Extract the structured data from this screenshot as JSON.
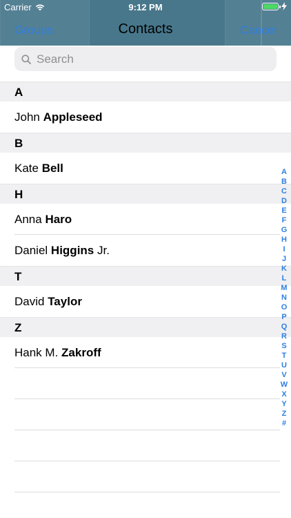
{
  "status_bar": {
    "carrier": "Carrier",
    "time": "9:12 PM"
  },
  "nav": {
    "left_button": "Groups",
    "title": "Contacts",
    "right_button": "Cancel"
  },
  "search": {
    "placeholder": "Search",
    "value": ""
  },
  "sections": [
    {
      "letter": "A",
      "contacts": [
        {
          "first": "John ",
          "last": "Appleseed",
          "suffix": ""
        }
      ]
    },
    {
      "letter": "B",
      "contacts": [
        {
          "first": "Kate ",
          "last": "Bell",
          "suffix": ""
        }
      ]
    },
    {
      "letter": "H",
      "contacts": [
        {
          "first": "Anna ",
          "last": "Haro",
          "suffix": ""
        },
        {
          "first": "Daniel ",
          "last": "Higgins",
          "suffix": " Jr."
        }
      ]
    },
    {
      "letter": "T",
      "contacts": [
        {
          "first": "David ",
          "last": "Taylor",
          "suffix": ""
        }
      ]
    },
    {
      "letter": "Z",
      "contacts": [
        {
          "first": "Hank M. ",
          "last": "Zakroff",
          "suffix": ""
        }
      ]
    }
  ],
  "index_letters": [
    "A",
    "B",
    "C",
    "D",
    "E",
    "F",
    "G",
    "H",
    "I",
    "J",
    "K",
    "L",
    "M",
    "N",
    "O",
    "P",
    "Q",
    "R",
    "S",
    "T",
    "U",
    "V",
    "W",
    "X",
    "Y",
    "Z",
    "#"
  ],
  "colors": {
    "nav_background": "#48778b",
    "accent_blue": "#2f7ee0",
    "battery_green": "#4cd964",
    "section_background": "#f0f0f2"
  },
  "icons": {
    "wifi": "wifi-icon",
    "battery": "battery-icon",
    "charging": "charging-bolt-icon",
    "search": "search-icon"
  }
}
